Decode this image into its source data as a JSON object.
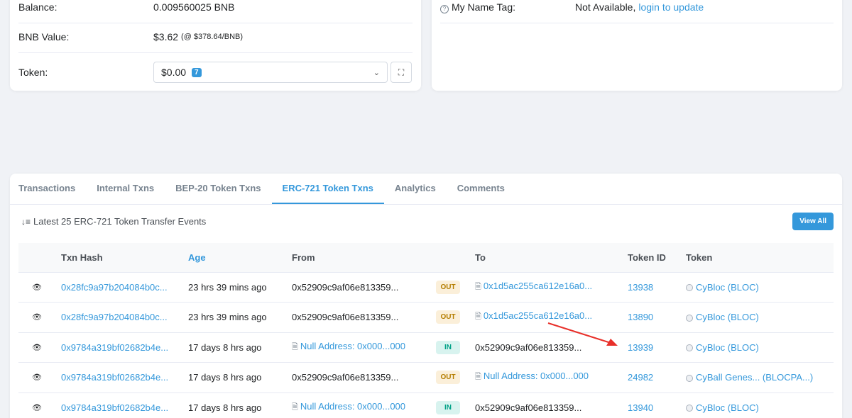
{
  "overview": {
    "balance_label": "Balance:",
    "balance_value": "0.009560025 BNB",
    "bnb_value_label": "BNB Value:",
    "bnb_value": "$3.62",
    "bnb_price": "(@ $378.64/BNB)",
    "token_label": "Token:",
    "token_value": "$0.00",
    "token_count": "7"
  },
  "more_info": {
    "name_tag_label": "My Name Tag:",
    "name_tag_value": "Not Available,",
    "login_link": "login to update"
  },
  "tabs": [
    {
      "label": "Transactions",
      "active": false
    },
    {
      "label": "Internal Txns",
      "active": false
    },
    {
      "label": "BEP-20 Token Txns",
      "active": false
    },
    {
      "label": "ERC-721 Token Txns",
      "active": true
    },
    {
      "label": "Analytics",
      "active": false
    },
    {
      "label": "Comments",
      "active": false
    }
  ],
  "events_title": "Latest 25 ERC-721 Token Transfer Events",
  "view_all": "View All",
  "columns": {
    "txn_hash": "Txn Hash",
    "age": "Age",
    "from": "From",
    "to": "To",
    "token_id": "Token ID",
    "token": "Token"
  },
  "rows": [
    {
      "hash": "0x28fc9a97b204084b0c...",
      "age": "23 hrs 39 mins ago",
      "from": "0x52909c9af06e813359...",
      "from_link": false,
      "dir": "OUT",
      "to": "0x1d5ac255ca612e16a0...",
      "to_link": true,
      "token_id": "13938",
      "token": "CyBloc (BLOC)"
    },
    {
      "hash": "0x28fc9a97b204084b0c...",
      "age": "23 hrs 39 mins ago",
      "from": "0x52909c9af06e813359...",
      "from_link": false,
      "dir": "OUT",
      "to": "0x1d5ac255ca612e16a0...",
      "to_link": true,
      "token_id": "13890",
      "token": "CyBloc (BLOC)"
    },
    {
      "hash": "0x9784a319bf02682b4e...",
      "age": "17 days 8 hrs ago",
      "from": "Null Address: 0x000...000",
      "from_link": true,
      "dir": "IN",
      "to": "0x52909c9af06e813359...",
      "to_link": false,
      "token_id": "13939",
      "token": "CyBloc (BLOC)"
    },
    {
      "hash": "0x9784a319bf02682b4e...",
      "age": "17 days 8 hrs ago",
      "from": "0x52909c9af06e813359...",
      "from_link": false,
      "dir": "OUT",
      "to": "Null Address: 0x000...000",
      "to_link": true,
      "token_id": "24982",
      "token": "CyBall Genes... (BLOCPA...)"
    },
    {
      "hash": "0x9784a319bf02682b4e...",
      "age": "17 days 8 hrs ago",
      "from": "Null Address: 0x000...000",
      "from_link": true,
      "dir": "IN",
      "to": "0x52909c9af06e813359...",
      "to_link": false,
      "token_id": "13940",
      "token": "CyBloc (BLOC)"
    }
  ],
  "colors": {
    "accent": "#3498db",
    "out_badge": "#fbefd9",
    "in_badge": "#d8f3ef",
    "annotation_arrow": "#e8302a"
  }
}
